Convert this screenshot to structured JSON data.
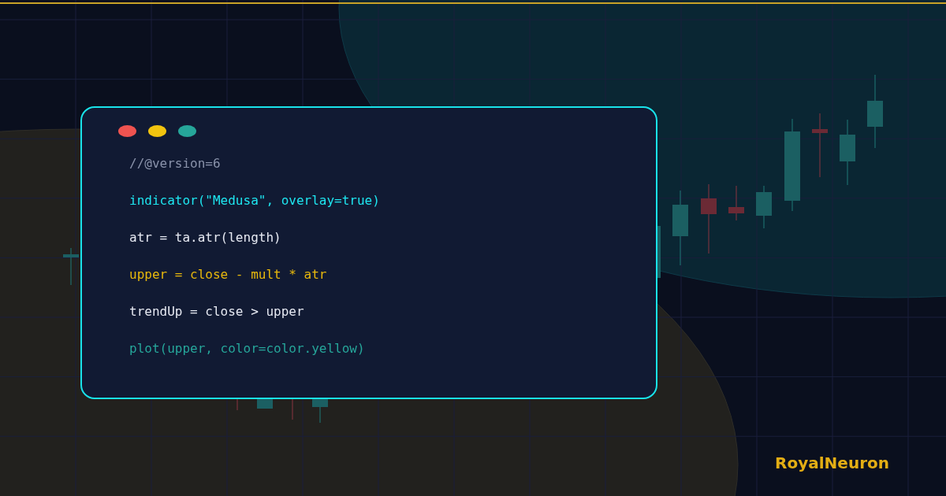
{
  "editor": {
    "window_dots": [
      {
        "color": "#ef5350"
      },
      {
        "color": "#f2c40f"
      },
      {
        "color": "#26a69a"
      }
    ],
    "code_lines": [
      {
        "text": "//@version=6",
        "color": "#8a93ab"
      },
      {
        "text": "indicator(\"Medusa\", overlay=true)",
        "color": "#1ee6f0"
      },
      {
        "text": "atr = ta.atr(length)",
        "color": "#e6e9f2"
      },
      {
        "text": "upper = close - mult * atr",
        "color": "#e8b80c"
      },
      {
        "text": "trendUp = close > upper",
        "color": "#e6e9f2"
      },
      {
        "text": "plot(upper, color=color.yellow)",
        "color": "#26a69a"
      }
    ]
  },
  "brand": "RoyalNeuron"
}
